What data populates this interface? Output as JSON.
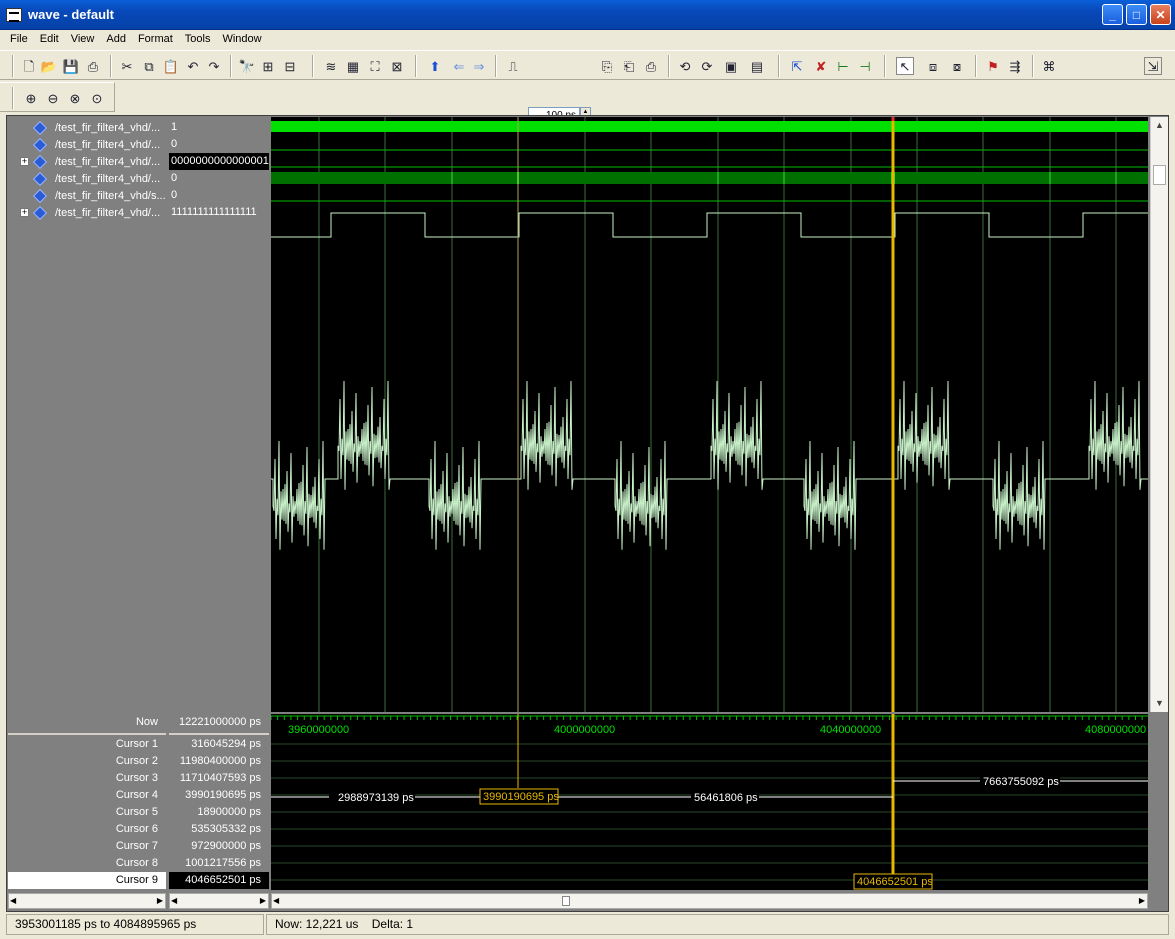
{
  "window": {
    "title": "wave - default"
  },
  "menu": [
    "File",
    "Edit",
    "View",
    "Add",
    "Format",
    "Tools",
    "Window"
  ],
  "toolbar": {
    "zoom_value": "100 ps"
  },
  "signals": [
    {
      "name": "/test_fir_filter4_vhd/...",
      "value": "1",
      "expandable": false
    },
    {
      "name": "/test_fir_filter4_vhd/...",
      "value": "0",
      "expandable": false
    },
    {
      "name": "/test_fir_filter4_vhd/...",
      "value": "0000000000000001",
      "expandable": true
    },
    {
      "name": "/test_fir_filter4_vhd/...",
      "value": "0",
      "expandable": false
    },
    {
      "name": "/test_fir_filter4_vhd/s...",
      "value": "0",
      "expandable": false
    },
    {
      "name": "/test_fir_filter4_vhd/...",
      "value": "1111111111111111",
      "expandable": true
    }
  ],
  "now": {
    "label": "Now",
    "value": "12221000000 ps"
  },
  "cursors": [
    {
      "name": "Cursor 1",
      "value": "316045294 ps"
    },
    {
      "name": "Cursor 2",
      "value": "11980400000 ps"
    },
    {
      "name": "Cursor 3",
      "value": "11710407593 ps"
    },
    {
      "name": "Cursor 4",
      "value": "3990190695 ps"
    },
    {
      "name": "Cursor 5",
      "value": "18900000 ps"
    },
    {
      "name": "Cursor 6",
      "value": "535305332 ps"
    },
    {
      "name": "Cursor 7",
      "value": "972900000 ps"
    },
    {
      "name": "Cursor 8",
      "value": "1001217556 ps"
    },
    {
      "name": "Cursor 9",
      "value": "4046652501 ps"
    }
  ],
  "timeline": {
    "ticks": [
      "3960000000",
      "4000000000",
      "4040000000",
      "4080000000"
    ],
    "range_start_ps": 3953001185,
    "range_end_ps": 4084895965
  },
  "cursor_labels": {
    "c4_box": "3990190695 ps",
    "c9_box": "4046652501 ps",
    "delta_left": "2988973139 ps",
    "delta_mid": "56461806 ps",
    "delta_right": "7663755092 ps"
  },
  "colors": {
    "wave_green": "#00e000",
    "grid": "#3a6b3a",
    "cursor_yellow": "#e8b800",
    "cursor_red": "#e03020",
    "analog": "#c8f0c8"
  },
  "status": {
    "range": "3953001185 ps to 4084895965 ps",
    "now": "Now: 12,221 us",
    "delta": "Delta: 1"
  }
}
